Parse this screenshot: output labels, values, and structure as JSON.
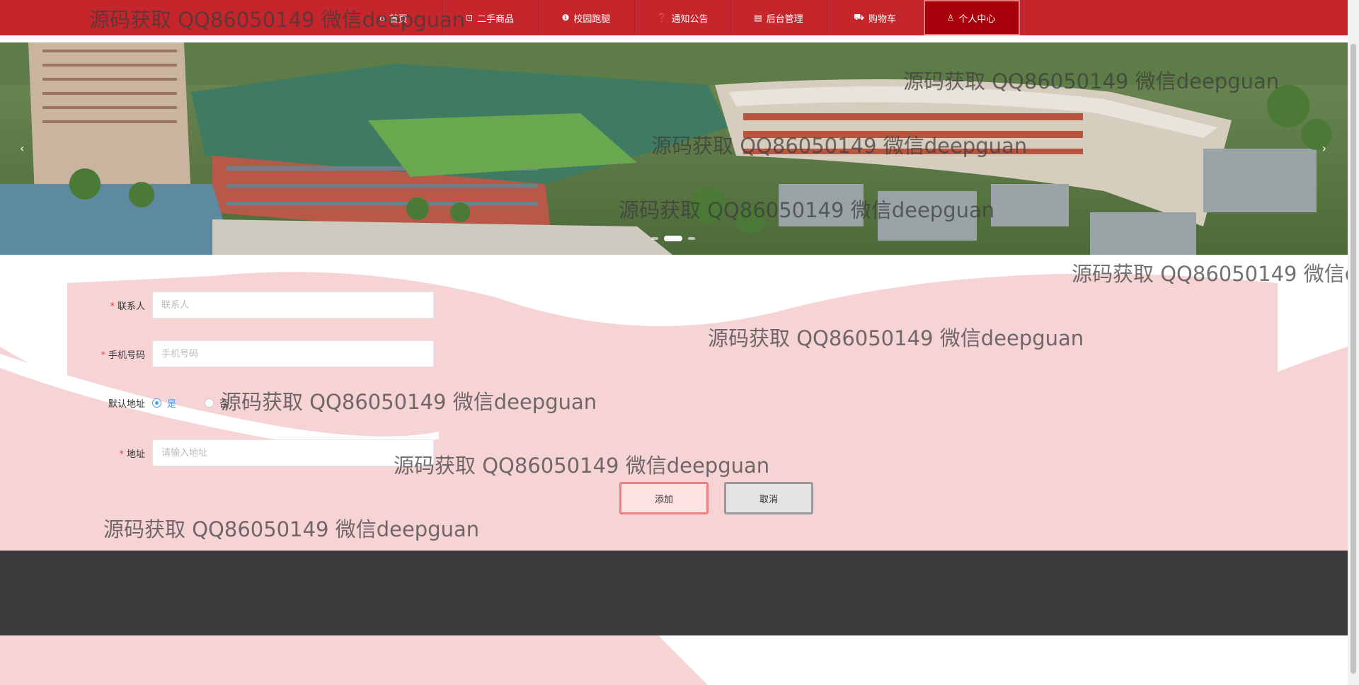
{
  "nav": {
    "items": [
      {
        "label": "首页",
        "icon": "home-icon"
      },
      {
        "label": "二手商品",
        "icon": "bag-icon"
      },
      {
        "label": "校园跑腿",
        "icon": "info-icon"
      },
      {
        "label": "通知公告",
        "icon": "question-icon"
      },
      {
        "label": "后台管理",
        "icon": "clipboard-icon"
      },
      {
        "label": "购物车",
        "icon": "cart-icon"
      },
      {
        "label": "个人中心",
        "icon": "user-icon"
      }
    ],
    "active_index": 6
  },
  "banner": {
    "prev": "‹",
    "next": "›",
    "slides": 3,
    "active_slide": 1
  },
  "form": {
    "contact": {
      "label": "联系人",
      "placeholder": "联系人"
    },
    "phone": {
      "label": "手机号码",
      "placeholder": "手机号码"
    },
    "default_address": {
      "label": "默认地址",
      "yes": "是",
      "no": "否",
      "selected": "是"
    },
    "address": {
      "label": "地址",
      "placeholder": "请输入地址"
    },
    "add_button": "添加",
    "cancel_button": "取消"
  },
  "watermark_text": "源码获取 QQ86050149 微信deepguan",
  "colors": {
    "nav_bg": "#c4262c",
    "nav_active": "#a8000b",
    "wave_pink": "#f6d4d6",
    "footer_bg": "#3c3c3f",
    "radio_blue": "#409eff"
  }
}
